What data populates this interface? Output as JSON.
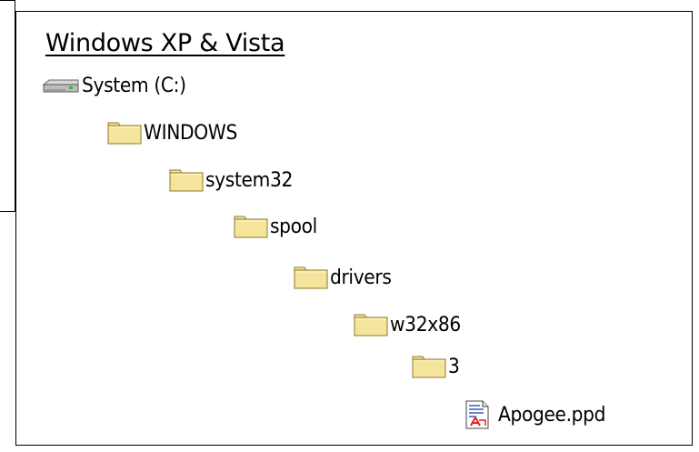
{
  "heading": "Windows XP & Vista",
  "tree": {
    "drive": {
      "label": "System (C:)",
      "icon": "drive-icon"
    },
    "windows": {
      "label": "WINDOWS",
      "icon": "folder-icon"
    },
    "system32": {
      "label": "system32",
      "icon": "folder-icon"
    },
    "spool": {
      "label": "spool",
      "icon": "folder-icon"
    },
    "drivers": {
      "label": "drivers",
      "icon": "folder-icon"
    },
    "w32x86": {
      "label": "w32x86",
      "icon": "folder-icon"
    },
    "three": {
      "label": "3",
      "icon": "folder-icon"
    },
    "file": {
      "label": "Apogee.ppd",
      "icon": "ppd-file-icon"
    }
  },
  "colors": {
    "folder_fill": "#F5E49C",
    "folder_outline": "#8C7A2A",
    "border": "#000000",
    "background": "#FFFFFF"
  }
}
